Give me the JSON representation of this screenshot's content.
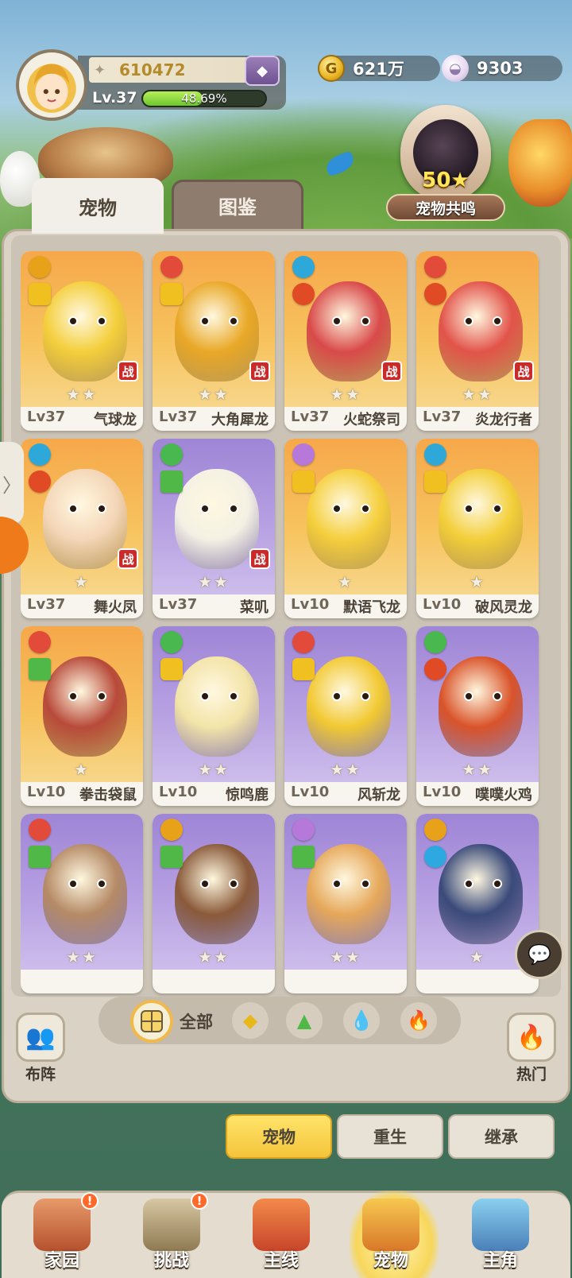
{
  "player": {
    "power": "610472",
    "level": "Lv.37",
    "exp_percent_text": "48.69%",
    "exp_fraction": 0.4869
  },
  "currency": {
    "gold": "621万",
    "shell": "9303"
  },
  "resonance": {
    "stars": "50★",
    "label": "宠物共鸣"
  },
  "tabs": {
    "pets": "宠物",
    "atlas": "图鉴"
  },
  "pets": [
    {
      "level": "Lv37",
      "name": "气球龙",
      "stars": "★★",
      "battle": "战",
      "bg": "orange"
    },
    {
      "level": "Lv37",
      "name": "大角犀龙",
      "stars": "★★",
      "battle": "战",
      "bg": "orange"
    },
    {
      "level": "Lv37",
      "name": "火蛇祭司",
      "stars": "★★",
      "battle": "战",
      "bg": "orange"
    },
    {
      "level": "Lv37",
      "name": "炎龙行者",
      "stars": "★★",
      "battle": "战",
      "bg": "orange"
    },
    {
      "level": "Lv37",
      "name": "舞火凤",
      "stars": "★",
      "battle": "战",
      "bg": "orange"
    },
    {
      "level": "Lv37",
      "name": "菜叽",
      "stars": "★★",
      "battle": "战",
      "bg": "purple"
    },
    {
      "level": "Lv10",
      "name": "默语飞龙",
      "stars": "★",
      "battle": "",
      "bg": "orange"
    },
    {
      "level": "Lv10",
      "name": "破风灵龙",
      "stars": "★",
      "battle": "",
      "bg": "orange"
    },
    {
      "level": "Lv10",
      "name": "拳击袋鼠",
      "stars": "★",
      "battle": "",
      "bg": "orange"
    },
    {
      "level": "Lv10",
      "name": "惊鸣鹿",
      "stars": "★★",
      "battle": "",
      "bg": "purple"
    },
    {
      "level": "Lv10",
      "name": "风斩龙",
      "stars": "★★",
      "battle": "",
      "bg": "purple"
    },
    {
      "level": "Lv10",
      "name": "噗噗火鸡",
      "stars": "★★",
      "battle": "",
      "bg": "purple"
    },
    {
      "level": "",
      "name": "",
      "stars": "★★",
      "battle": "",
      "bg": "purple"
    },
    {
      "level": "",
      "name": "",
      "stars": "★★",
      "battle": "",
      "bg": "purple"
    },
    {
      "level": "",
      "name": "",
      "stars": "★★",
      "battle": "",
      "bg": "purple"
    },
    {
      "level": "",
      "name": "",
      "stars": "★",
      "battle": "",
      "bg": "purple"
    }
  ],
  "filters": {
    "formation": "布阵",
    "all": "全部",
    "hot": "热门"
  },
  "actions": {
    "pets": "宠物",
    "rebirth": "重生",
    "inherit": "继承"
  },
  "nav": [
    {
      "label": "家园",
      "badge": "!"
    },
    {
      "label": "挑战",
      "badge": "!"
    },
    {
      "label": "主线",
      "badge": ""
    },
    {
      "label": "宠物",
      "badge": ""
    },
    {
      "label": "主角",
      "badge": ""
    }
  ],
  "colors": {
    "orange_card": "#f6a84a",
    "purple_card": "#9f85d6",
    "battle_badge": "#c92b2b",
    "exp_fill": "#6cc62d",
    "active_button": "#f4c43a"
  }
}
